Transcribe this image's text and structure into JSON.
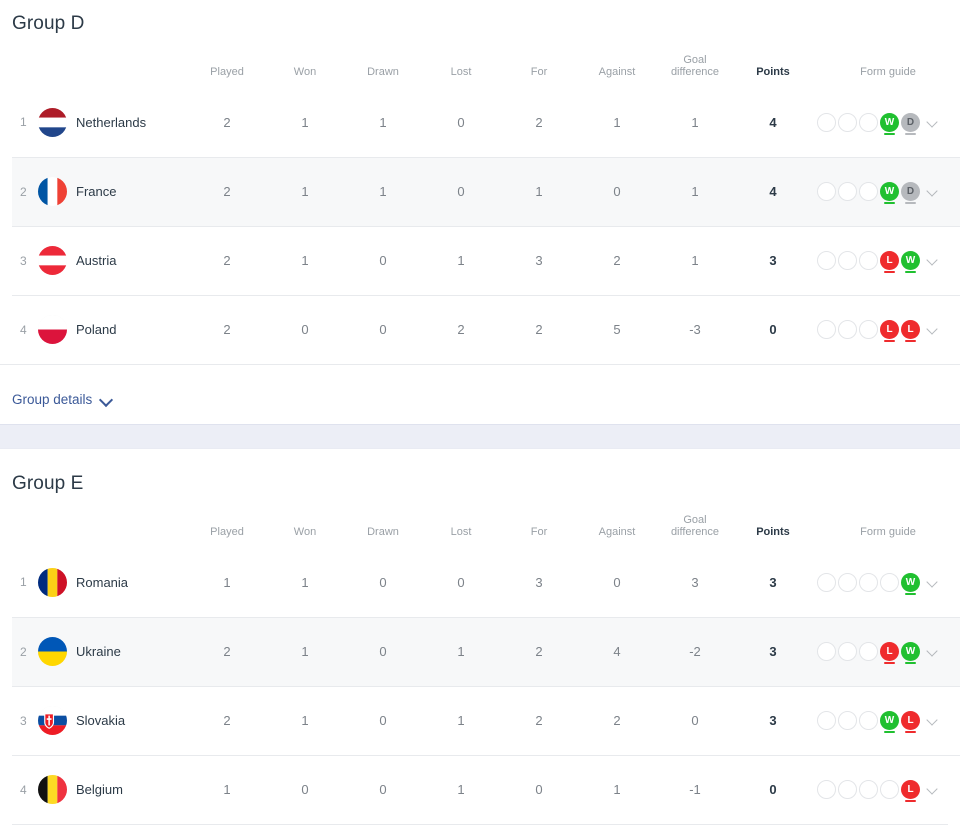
{
  "columns": {
    "rank": "",
    "team": "",
    "played": "Played",
    "won": "Won",
    "drawn": "Drawn",
    "lost": "Lost",
    "for": "For",
    "against": "Against",
    "goal_difference_line1": "Goal",
    "goal_difference_line2": "difference",
    "points": "Points",
    "form_guide": "Form guide"
  },
  "group_details": {
    "label": "Group details",
    "chevron_icon": "chevron-down-icon"
  },
  "groups": [
    {
      "title": "Group D",
      "rows": [
        {
          "rank": "1",
          "team": "Netherlands",
          "flag": "netherlands-flag",
          "played": "2",
          "won": "1",
          "drawn": "1",
          "lost": "0",
          "for": "2",
          "against": "1",
          "gd": "1",
          "points": "4",
          "empty_pips": 3,
          "form": [
            "W",
            "D"
          ]
        },
        {
          "rank": "2",
          "team": "France",
          "flag": "france-flag",
          "played": "2",
          "won": "1",
          "drawn": "1",
          "lost": "0",
          "for": "1",
          "against": "0",
          "gd": "1",
          "points": "4",
          "empty_pips": 3,
          "form": [
            "W",
            "D"
          ]
        },
        {
          "rank": "3",
          "team": "Austria",
          "flag": "austria-flag",
          "played": "2",
          "won": "1",
          "drawn": "0",
          "lost": "1",
          "for": "3",
          "against": "2",
          "gd": "1",
          "points": "3",
          "empty_pips": 3,
          "form": [
            "L",
            "W"
          ]
        },
        {
          "rank": "4",
          "team": "Poland",
          "flag": "poland-flag",
          "played": "2",
          "won": "0",
          "drawn": "0",
          "lost": "2",
          "for": "2",
          "against": "5",
          "gd": "-3",
          "points": "0",
          "empty_pips": 3,
          "form": [
            "L",
            "L"
          ]
        }
      ]
    },
    {
      "title": "Group E",
      "rows": [
        {
          "rank": "1",
          "team": "Romania",
          "flag": "romania-flag",
          "played": "1",
          "won": "1",
          "drawn": "0",
          "lost": "0",
          "for": "3",
          "against": "0",
          "gd": "3",
          "points": "3",
          "empty_pips": 4,
          "form": [
            "W"
          ]
        },
        {
          "rank": "2",
          "team": "Ukraine",
          "flag": "ukraine-flag",
          "played": "2",
          "won": "1",
          "drawn": "0",
          "lost": "1",
          "for": "2",
          "against": "4",
          "gd": "-2",
          "points": "3",
          "empty_pips": 3,
          "form": [
            "L",
            "W"
          ]
        },
        {
          "rank": "3",
          "team": "Slovakia",
          "flag": "slovakia-flag",
          "played": "2",
          "won": "1",
          "drawn": "0",
          "lost": "1",
          "for": "2",
          "against": "2",
          "gd": "0",
          "points": "3",
          "empty_pips": 3,
          "form": [
            "W",
            "L"
          ]
        },
        {
          "rank": "4",
          "team": "Belgium",
          "flag": "belgium-flag",
          "played": "1",
          "won": "0",
          "drawn": "0",
          "lost": "1",
          "for": "0",
          "against": "1",
          "gd": "-1",
          "points": "0",
          "empty_pips": 4,
          "form": [
            "L"
          ]
        }
      ]
    }
  ],
  "colors": {
    "win": "#20c030",
    "loss": "#ef2b2d",
    "draw": "#b6b9bd",
    "link": "#3b5998",
    "text": "#2c3a47",
    "muted": "#9aa0a6",
    "band": "#eceef6"
  }
}
